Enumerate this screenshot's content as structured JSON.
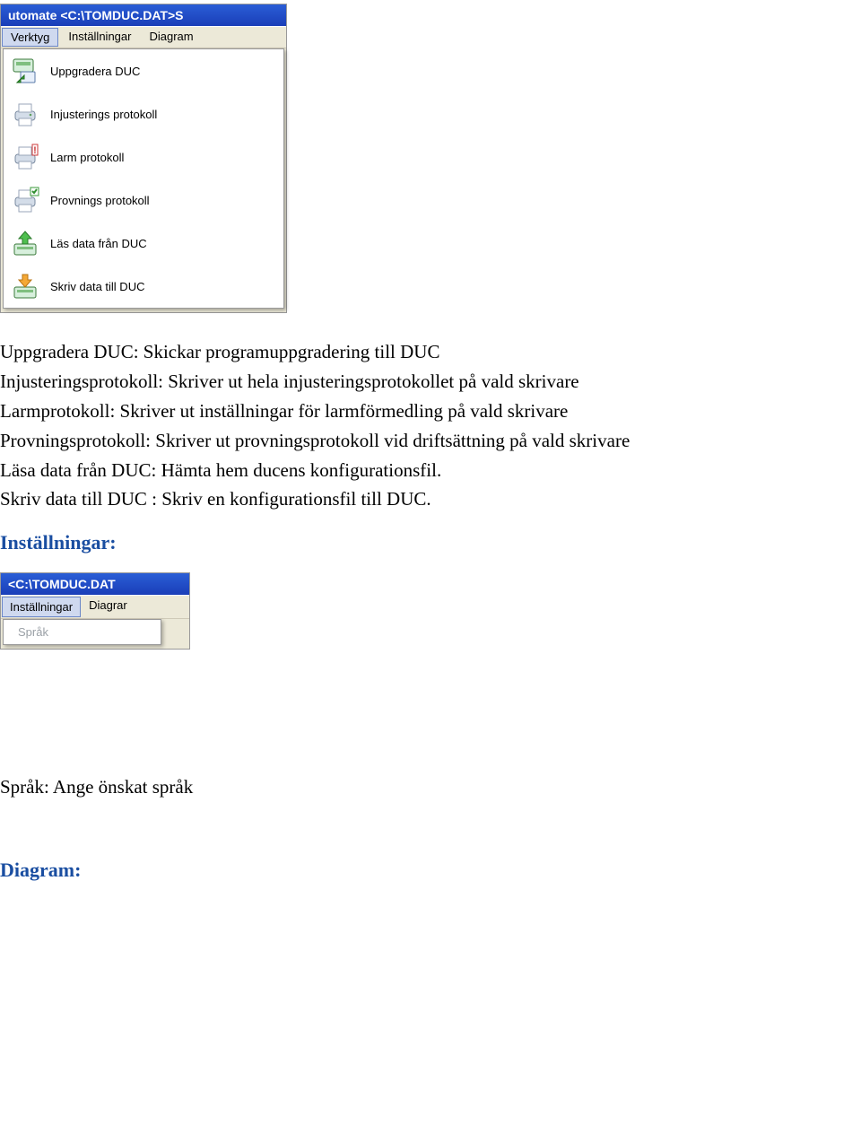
{
  "screenshot1": {
    "title": "utomate  <C:\\TOMDUC.DAT>S",
    "menubar": [
      "Verktyg",
      "Inställningar",
      "Diagram"
    ],
    "menubar_selected_index": 0,
    "menu_items": [
      {
        "label": "Uppgradera DUC",
        "icon": "upgrade-icon"
      },
      {
        "label": "Injusterings protokoll",
        "icon": "printer-icon"
      },
      {
        "label": "Larm protokoll",
        "icon": "printer-alert-icon"
      },
      {
        "label": "Provnings protokoll",
        "icon": "printer-check-icon"
      },
      {
        "label": "Läs data från DUC",
        "icon": "upload-icon"
      },
      {
        "label": "Skriv data till DUC",
        "icon": "download-icon"
      }
    ]
  },
  "body_paragraphs": [
    "Uppgradera DUC: Skickar programuppgradering till DUC",
    "Injusteringsprotokoll: Skriver ut hela injusteringsprotokollet på vald skrivare",
    "Larmprotokoll: Skriver ut inställningar för larmförmedling på vald skrivare",
    "Provningsprotokoll: Skriver ut provningsprotokoll vid driftsättning på vald skrivare",
    "Läsa data från DUC: Hämta hem ducens konfigurationsfil.",
    "Skriv data till DUC : Skriv en konfigurationsfil till DUC."
  ],
  "heading2": "Inställningar:",
  "screenshot2": {
    "title": "  <C:\\TOMDUC.DAT",
    "menubar": [
      "Inställningar",
      "Diagrar"
    ],
    "menubar_selected_index": 0,
    "menu_items": [
      {
        "label": "Språk",
        "disabled": true
      }
    ]
  },
  "body_paragraph2": "Språk: Ange önskat språk",
  "heading3": "Diagram:"
}
